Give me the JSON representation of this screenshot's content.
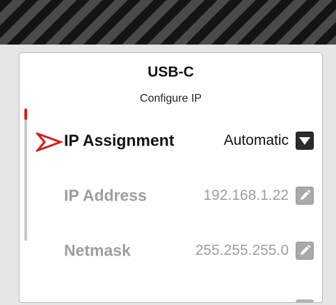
{
  "header": {
    "pattern": "hazard-stripes"
  },
  "dialog": {
    "title": "USB-C",
    "subtitle": "Configure IP",
    "rows": [
      {
        "label": "IP Assignment",
        "value": "Automatic",
        "control": "chevron-down-icon",
        "state": "selected"
      },
      {
        "label": "IP Address",
        "value": "192.168.1.22",
        "control": "pencil-icon",
        "state": "disabled"
      },
      {
        "label": "Netmask",
        "value": "255.255.255.0",
        "control": "pencil-icon",
        "state": "disabled"
      }
    ],
    "scroll_position": 0.0
  },
  "colors": {
    "accent": "#d81b1b",
    "text_primary": "#111111",
    "text_disabled": "#9e9e9e",
    "dropdown_button": "#2c2c2c",
    "edit_button": "#a9a9a9"
  }
}
